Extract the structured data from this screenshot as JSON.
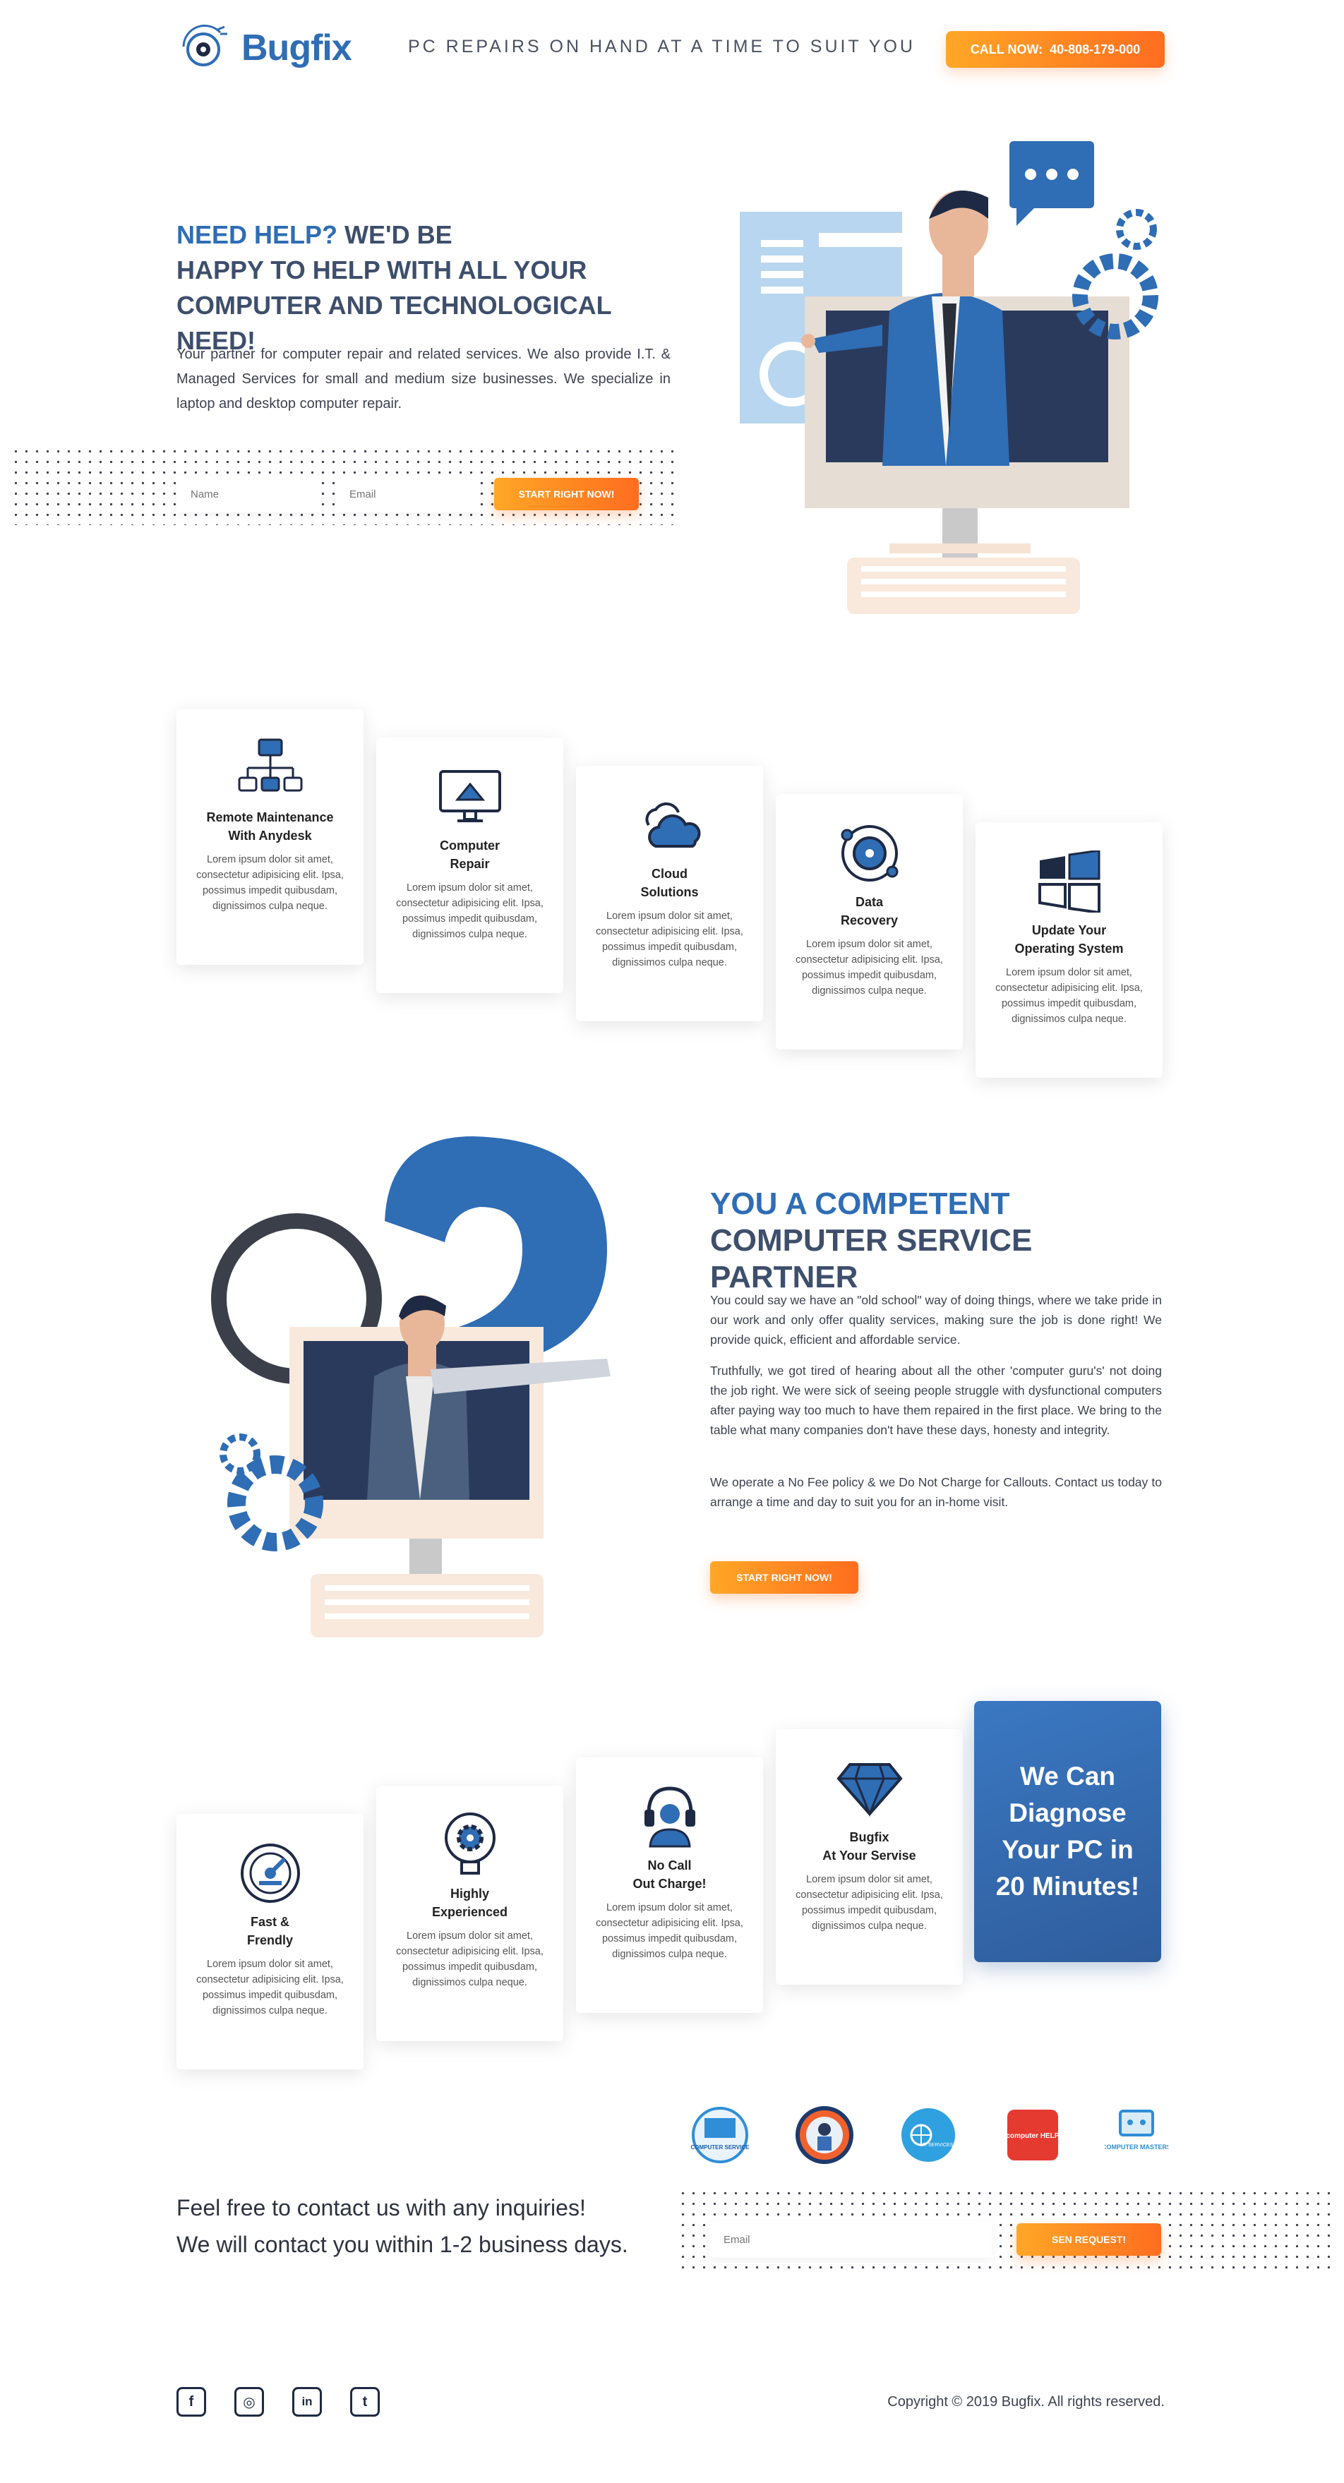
{
  "header": {
    "logo_text": "Bugfix",
    "tagline": "PC REPAIRS ON HAND AT A TIME TO SUIT YOU",
    "call_label": "CALL NOW:",
    "call_number": "40-808-179-000"
  },
  "hero": {
    "title_highlight": "NEED HELP?",
    "title_rest_1": " WE'D BE",
    "title_rest_2": "HAPPY TO HELP WITH ALL YOUR",
    "title_rest_3": "COMPUTER AND TECHNOLOGICAL NEED!",
    "text": "Your partner for computer repair and related services. We also provide I.T. & Managed Services for small and medium size businesses. We specialize in laptop and desktop computer repair.",
    "name_placeholder": "Name",
    "email_placeholder": "Email",
    "button": "START RIGHT NOW!"
  },
  "services": [
    {
      "icon": "network-icon",
      "title": "Remote Maintenance\nWith Anydesk",
      "text": "Lorem ipsum dolor sit amet, consectetur adipisicing elit. Ipsa, possimus impedit quibusdam, dignissimos culpa neque."
    },
    {
      "icon": "monitor-repair-icon",
      "title": "Computer\nRepair",
      "text": "Lorem ipsum dolor sit amet, consectetur adipisicing elit. Ipsa, possimus impedit quibusdam, dignissimos culpa neque."
    },
    {
      "icon": "cloud-icon",
      "title": "Cloud\nSolutions",
      "text": "Lorem ipsum dolor sit amet, consectetur adipisicing elit. Ipsa, possimus impedit quibusdam, dignissimos culpa neque."
    },
    {
      "icon": "data-recovery-icon",
      "title": "Data\nRecovery",
      "text": "Lorem ipsum dolor sit amet, consectetur adipisicing elit. Ipsa, possimus impedit quibusdam, dignissimos culpa neque."
    },
    {
      "icon": "windows-icon",
      "title": "Update Your\nOperating System",
      "text": "Lorem ipsum dolor sit amet, consectetur adipisicing elit. Ipsa, possimus impedit quibusdam, dignissimos culpa neque."
    }
  ],
  "partner": {
    "title_1": "YOU A COMPETENT",
    "title_2": "COMPUTER SERVICE PARTNER",
    "p1": "You could say we have an \"old school\" way of doing things, where we take pride in our work and only offer quality services, making sure the job is done right! We provide quick, efficient and affordable service.",
    "p2": "Truthfully, we got tired of hearing about all the other 'computer guru's' not doing the job right. We were sick of seeing people struggle with dysfunctional computers after paying way too much to have them repaired in the first place. We bring to the table what many companies don't have these days, honesty and integrity.",
    "p3": "We operate a No Fee policy & we Do Not Charge for Callouts. Contact us today to arrange a time and day to suit you for an in-home visit.",
    "button": "START RIGHT NOW!"
  },
  "features": [
    {
      "icon": "speedometer-icon",
      "title": "Fast &\nFrendly",
      "text": "Lorem ipsum dolor sit amet, consectetur adipisicing elit. Ipsa, possimus impedit quibusdam, dignissimos culpa neque."
    },
    {
      "icon": "gear-bulb-icon",
      "title": "Highly\nExperienced",
      "text": "Lorem ipsum dolor sit amet, consectetur adipisicing elit. Ipsa, possimus impedit quibusdam, dignissimos culpa neque."
    },
    {
      "icon": "headset-icon",
      "title": "No Call\nOut Charge!",
      "text": "Lorem ipsum dolor sit amet, consectetur adipisicing elit. Ipsa, possimus impedit quibusdam, dignissimos culpa neque."
    },
    {
      "icon": "diamond-icon",
      "title": "Bugfix\nAt Your Servise",
      "text": "Lorem ipsum dolor sit amet, consectetur adipisicing elit. Ipsa, possimus impedit quibusdam, dignissimos culpa neque."
    }
  ],
  "diagnose": "We Can Diagnose Your PC in 20 Minutes!",
  "partner_logos": [
    {
      "name": "computer-service-logo",
      "text": "COMPUTER SERVICE"
    },
    {
      "name": "repairman-logo",
      "text": ""
    },
    {
      "name": "it-services-logo",
      "text": "I.T. SERVICES"
    },
    {
      "name": "computer-help-logo",
      "text": "computer HELP"
    },
    {
      "name": "computer-masters-logo",
      "text": "COMPUTER MASTERS"
    }
  ],
  "contact": {
    "line1": "Feel free to contact us with any inquiries!",
    "line2": "We will contact you within 1-2 business days.",
    "email_placeholder": "Email",
    "button": "SEN REQUEST!"
  },
  "footer": {
    "social": [
      "f",
      "◎",
      "in",
      "t"
    ],
    "copyright": "Copyright © 2019 Bugfix. All rights reserved."
  },
  "colors": {
    "brand_blue": "#2f6db5",
    "accent_orange": "#ff8a26",
    "navy": "#3e4f6c"
  }
}
